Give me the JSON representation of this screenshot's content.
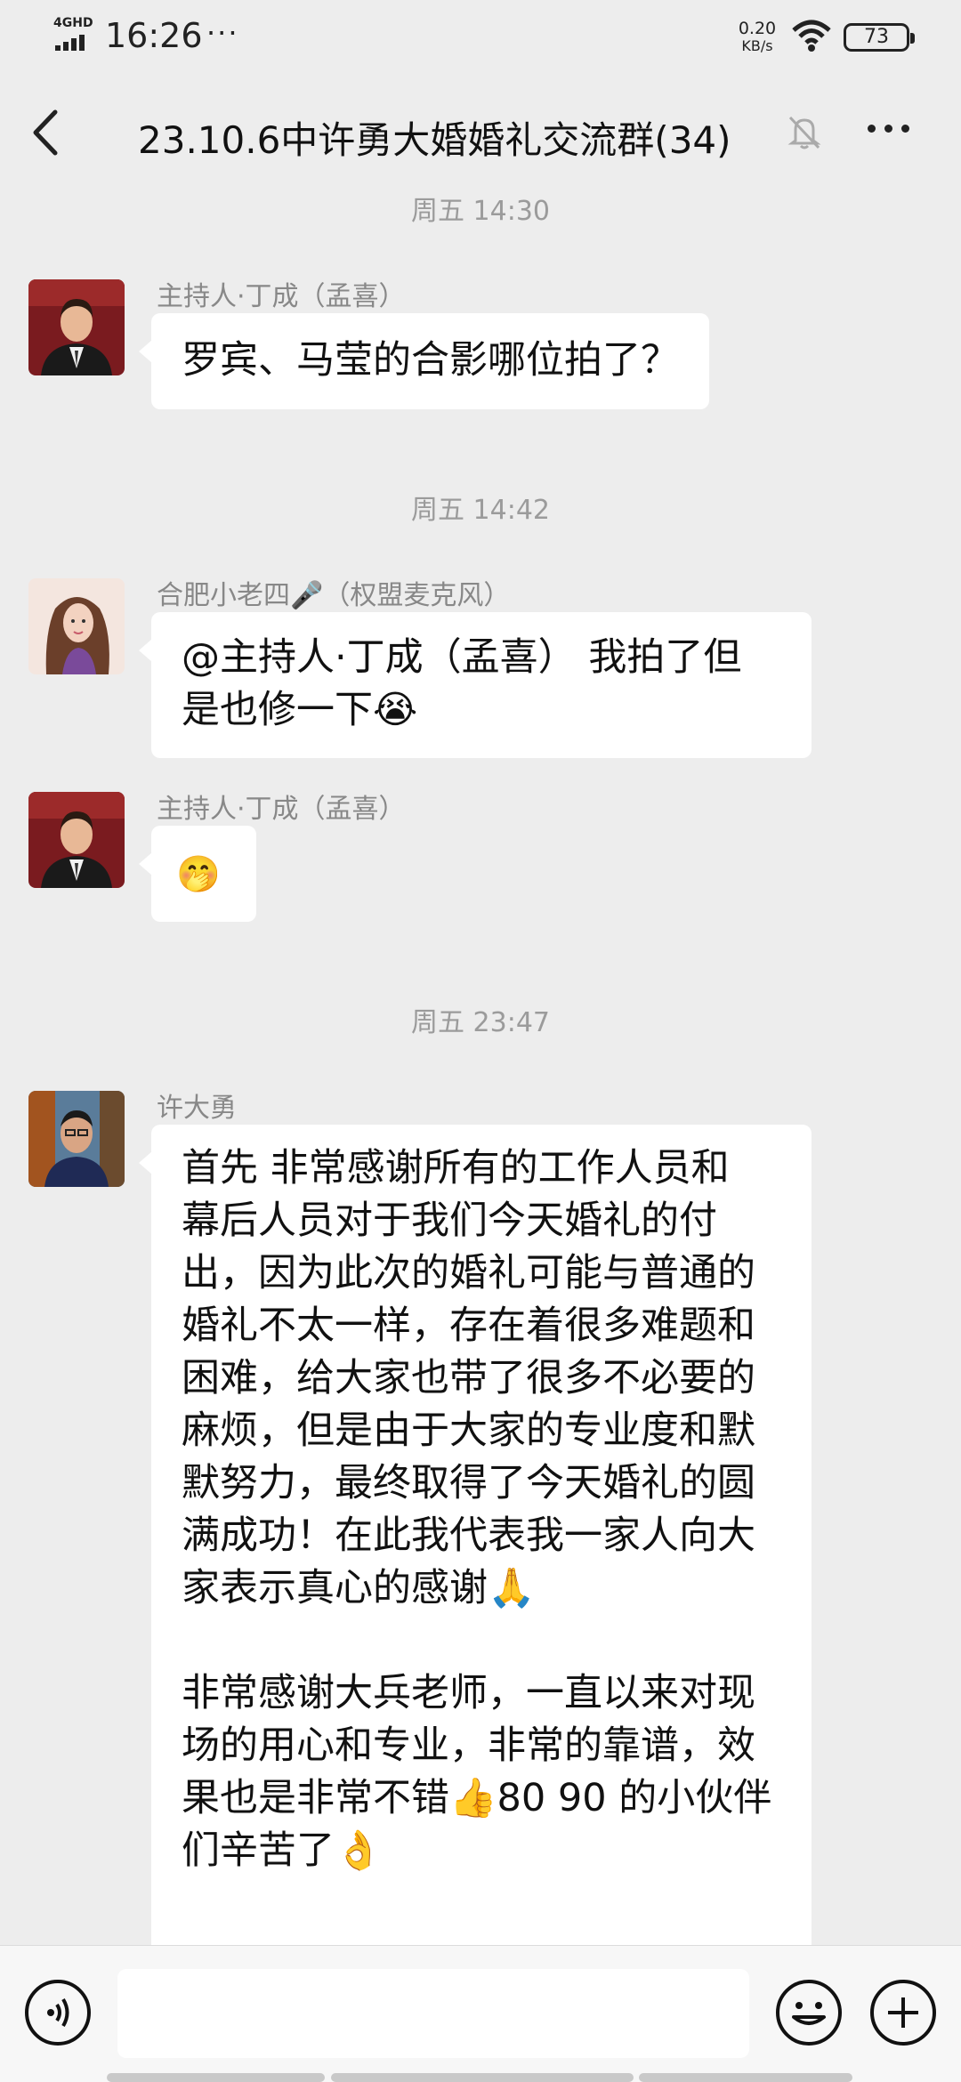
{
  "status_bar": {
    "network": "4GHD",
    "time": "16:26",
    "more_dots": "···",
    "speed_value": "0.20",
    "speed_unit": "KB/s",
    "battery": "73"
  },
  "header": {
    "title": "23.10.6中许勇大婚婚礼交流群(34)"
  },
  "chat": {
    "timestamps": [
      "周五 14:30",
      "周五 14:42",
      "周五 23:47"
    ],
    "messages": [
      {
        "sender": "主持人·丁成（孟喜）",
        "lines": [
          "罗宾、马莹的合影哪位拍了？"
        ]
      },
      {
        "sender": "合肥小老四🎤（权盟麦克风）",
        "lines": [
          "@主持人·丁成（孟喜） 我拍了但",
          "是也修一下😭"
        ]
      },
      {
        "sender": "主持人·丁成（孟喜）",
        "lines": [
          "🤭"
        ]
      },
      {
        "sender": "许大勇",
        "lines": [
          "首先 非常感谢所有的工作人员和",
          "幕后人员对于我们今天婚礼的付",
          "出，因为此次的婚礼可能与普通的",
          "婚礼不太一样，存在着很多难题和",
          "困难，给大家也带了很多不必要的",
          "麻烦，但是由于大家的专业度和默",
          "默努力，最终取得了今天婚礼的圆",
          "满成功！在此我代表我一家人向大",
          "家表示真心的感谢🙏",
          "",
          "非常感谢大兵老师，一直以来对现",
          "场的用心和专业，非常的靠谱，效",
          "果也是非常不错👍80 90 的小伙伴",
          "们辛苦了👌"
        ]
      }
    ]
  },
  "colors": {
    "background": "#ededed",
    "bubble": "#ffffff",
    "timestamp": "#9b9b9b",
    "sender": "#888888"
  },
  "icons": [
    "back-arrow-icon",
    "mute-bell-icon",
    "more-icon",
    "voice-icon",
    "emoji-icon",
    "plus-icon",
    "wifi-icon",
    "battery-icon",
    "signal-icon"
  ]
}
